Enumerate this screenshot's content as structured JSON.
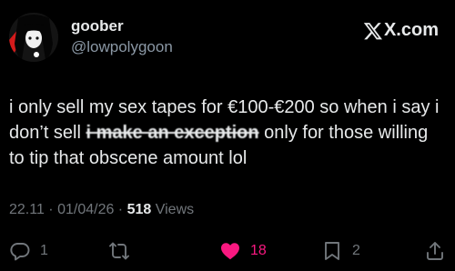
{
  "author": {
    "display_name": "goober",
    "handle": "@lowpolygoon",
    "avatar_icon": "avatar-image"
  },
  "brand": {
    "text": "X.com",
    "icon": "x-logo-icon"
  },
  "post": {
    "text_before": "i only sell my sex tapes for €100-€200 so when i say i don’t sell ",
    "text_redacted": "i make an exception",
    "text_after": " only for those willing to tip that obscene amount lol"
  },
  "meta": {
    "time": "22.11",
    "sep1": " · ",
    "date": "01/04/26",
    "sep2": " · ",
    "views_count": "518",
    "views_label": " Views"
  },
  "actions": {
    "replies": "1",
    "reposts": "",
    "likes": "18",
    "bookmarks": "2",
    "icons": [
      "reply-icon",
      "repost-icon",
      "like-icon",
      "bookmark-icon",
      "share-icon"
    ]
  },
  "colors": {
    "background": "#000000",
    "text": "#e7e9ea",
    "muted": "#71767b",
    "like": "#f91880"
  }
}
